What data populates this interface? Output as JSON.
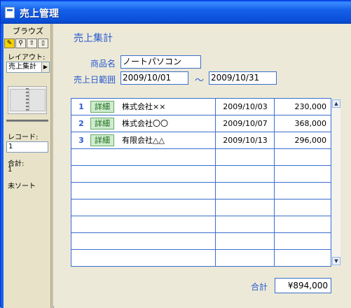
{
  "window": {
    "title": "売上管理"
  },
  "sidebar": {
    "browse_label": "ブラウズ",
    "mode_tabs": [
      "✎",
      "⚲",
      "⇧",
      "▯"
    ],
    "layout_label": "レイアウト:",
    "layout_value": "売上集計",
    "record_label": "レコード:",
    "record_value": "1",
    "total_label": "合計:",
    "total_value": "1",
    "sort_status": "未ソート"
  },
  "form": {
    "heading": "売上集計",
    "product_label": "商品名",
    "product_value": "ノートパソコン",
    "date_range_label": "売上日範囲",
    "date_from": "2009/10/01",
    "tilde": "～",
    "date_to": "2009/10/31"
  },
  "table": {
    "detail_label": "詳細",
    "rows": [
      {
        "index": "1",
        "company": "株式会社××",
        "date": "2009/10/03",
        "amount": "230,000"
      },
      {
        "index": "2",
        "company": "株式会社〇〇",
        "date": "2009/10/07",
        "amount": "368,000"
      },
      {
        "index": "3",
        "company": "有限会社△△",
        "date": "2009/10/13",
        "amount": "296,000"
      }
    ],
    "empty_rows": 7
  },
  "summary": {
    "total_label": "合計",
    "total_value": "¥894,000"
  },
  "colors": {
    "accent": "#2a5bd0",
    "titlebar": "#0a4fd8",
    "detail_button": "#cfeccf"
  }
}
